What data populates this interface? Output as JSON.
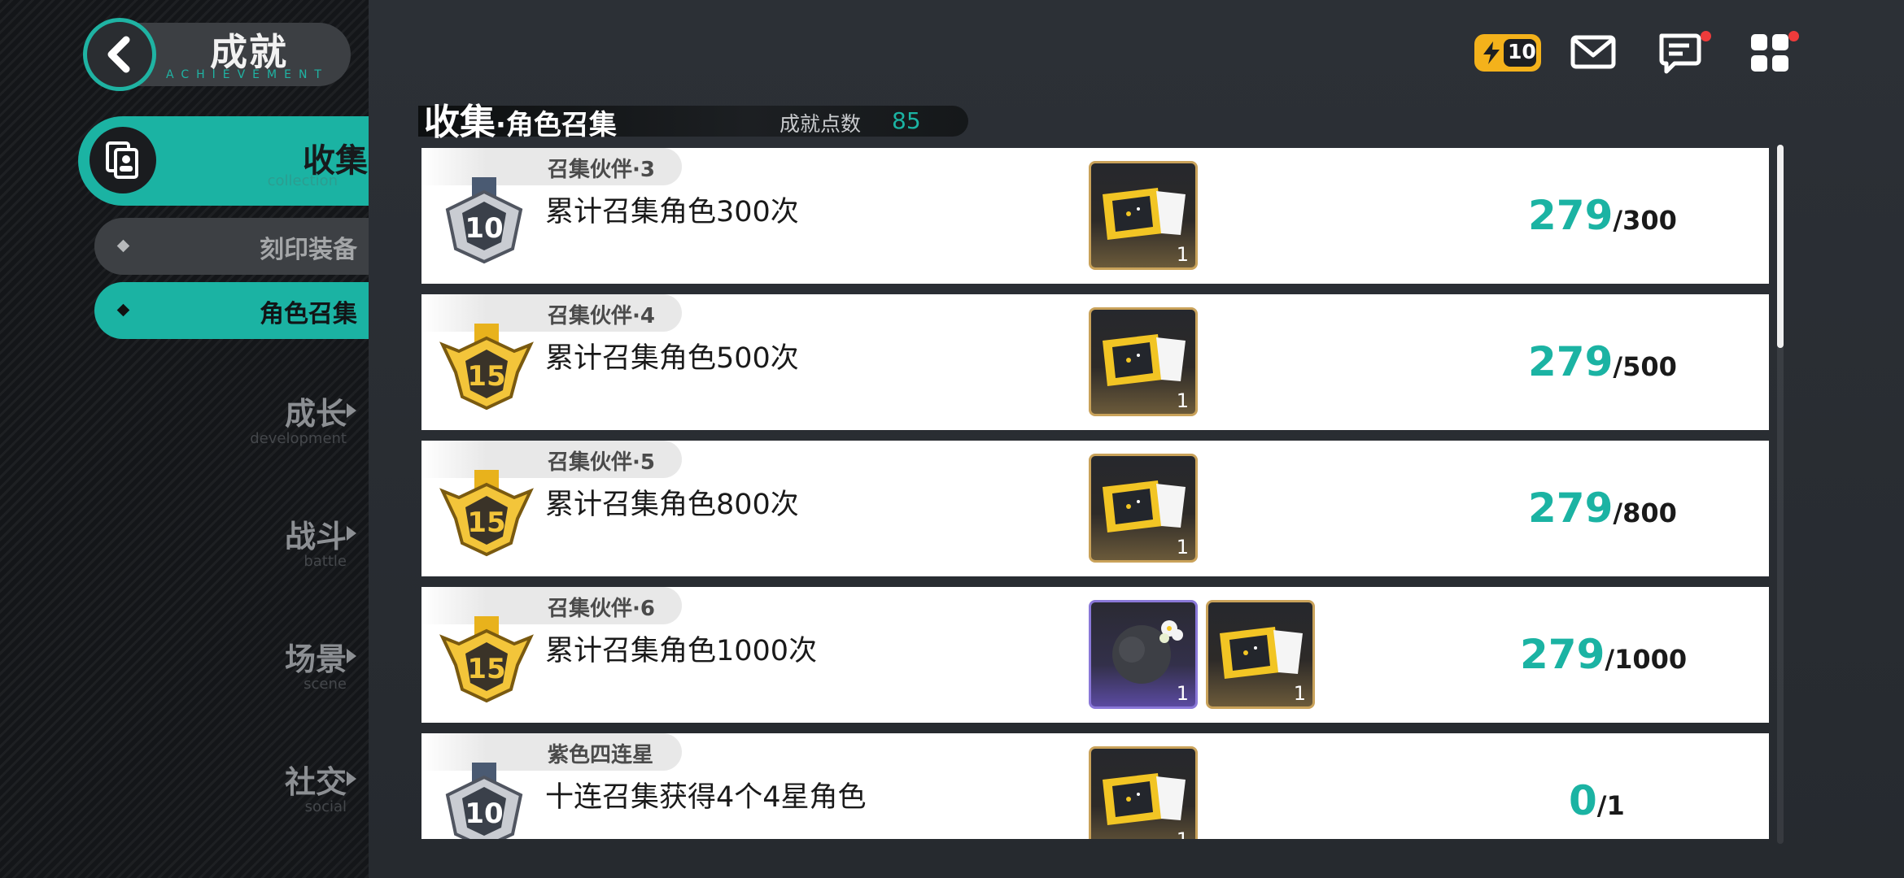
{
  "header": {
    "title": "成就",
    "subtitle": "ACHIEVEMENT",
    "energy_count": "10",
    "icons": [
      "back-icon",
      "energy-icon",
      "mail-icon",
      "chat-icon",
      "menu-grid-icon"
    ]
  },
  "sidebar": {
    "active_category": {
      "label": "收集",
      "sub": "collection",
      "icon": "collection-icon"
    },
    "sub_items": [
      {
        "label": "刻印装备",
        "selected": false
      },
      {
        "label": "角色召集",
        "selected": true
      }
    ],
    "categories": [
      {
        "label": "成长",
        "sub": "development"
      },
      {
        "label": "战斗",
        "sub": "battle"
      },
      {
        "label": "场景",
        "sub": "scene"
      },
      {
        "label": "社交",
        "sub": "social"
      }
    ]
  },
  "section": {
    "title": "收集",
    "title_small": "·角色召集",
    "points_label": "成就点数",
    "points_value": "85"
  },
  "achievements": [
    {
      "tag": "召集伙伴·3",
      "desc": "累计召集角色300次",
      "medal": "10",
      "medal_color": "silver",
      "rewards": [
        {
          "type": "ticket",
          "count": "1"
        }
      ],
      "current": "279",
      "total": "/300"
    },
    {
      "tag": "召集伙伴·4",
      "desc": "累计召集角色500次",
      "medal": "15",
      "medal_color": "gold",
      "rewards": [
        {
          "type": "ticket",
          "count": "1"
        }
      ],
      "current": "279",
      "total": "/500"
    },
    {
      "tag": "召集伙伴·5",
      "desc": "累计召集角色800次",
      "medal": "15",
      "medal_color": "gold",
      "rewards": [
        {
          "type": "ticket",
          "count": "1"
        }
      ],
      "current": "279",
      "total": "/800"
    },
    {
      "tag": "召集伙伴·6",
      "desc": "累计召集角色1000次",
      "medal": "15",
      "medal_color": "gold",
      "rewards": [
        {
          "type": "orb",
          "count": "1"
        },
        {
          "type": "ticket",
          "count": "1"
        }
      ],
      "current": "279",
      "total": "/1000"
    },
    {
      "tag": "紫色四连星",
      "desc": "十连召集获得4个4星角色",
      "medal": "10",
      "medal_color": "silver",
      "rewards": [
        {
          "type": "ticket",
          "count": "1"
        }
      ],
      "current": "0",
      "total": "/1"
    }
  ],
  "colors": {
    "accent": "#1bb3a3",
    "gold": "#f4b21b",
    "alert": "#ee3b3b"
  }
}
